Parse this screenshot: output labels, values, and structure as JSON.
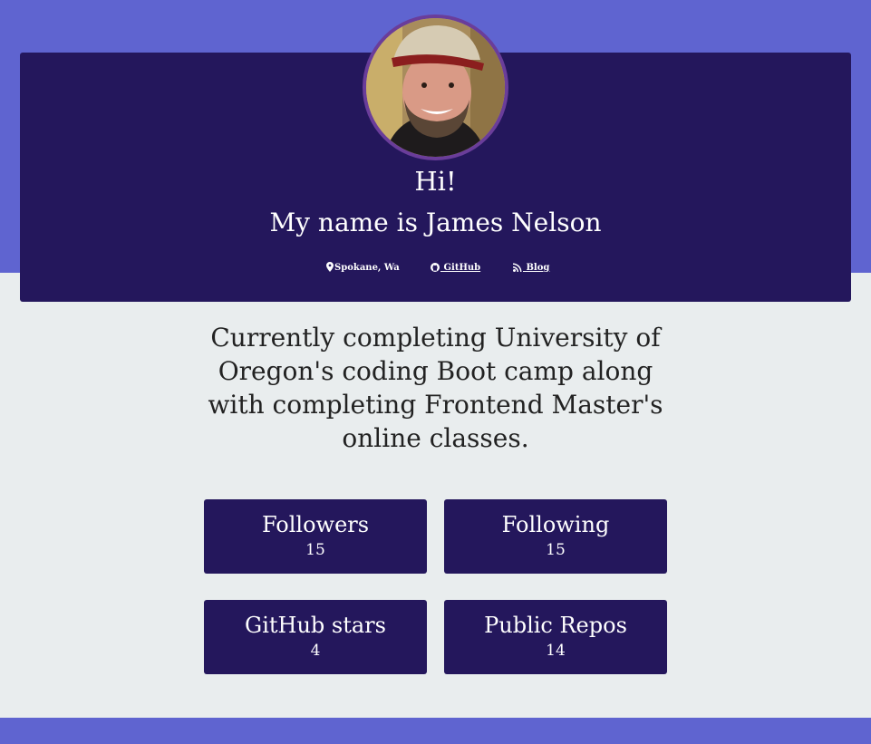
{
  "header": {
    "greeting": "Hi!",
    "name": "My name is James Nelson",
    "links": {
      "location": "Spokane, Wa",
      "github": " GitHub",
      "blog": " Blog"
    }
  },
  "bio": "Currently completing University of Oregon's coding Boot camp along with completing Frontend Master's online classes.",
  "stats": {
    "followers": {
      "label": "Followers",
      "value": "15"
    },
    "following": {
      "label": "Following",
      "value": "15"
    },
    "stars": {
      "label": "GitHub stars",
      "value": "4"
    },
    "repos": {
      "label": "Public Repos",
      "value": "14"
    }
  },
  "colors": {
    "band": "#5f64d0",
    "card": "#24175c",
    "background": "#e9edee",
    "avatar_border": "#6a3d9a"
  },
  "icons": {
    "location": "map-marker-icon",
    "github": "github-icon",
    "blog": "rss-icon"
  }
}
